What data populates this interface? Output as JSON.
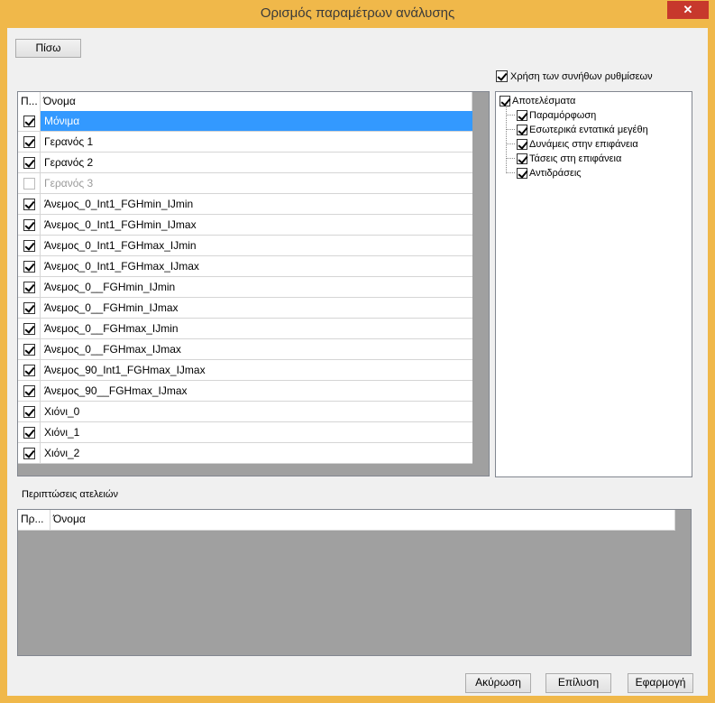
{
  "window": {
    "title": "Ορισμός παραμέτρων ανάλυσης",
    "close_glyph": "✕"
  },
  "toolbar": {
    "back_label": "Πίσω"
  },
  "defaults": {
    "label": "Χρήση των συνήθων ρυθμίσεων",
    "checked": true
  },
  "load_cases": {
    "headers": {
      "check": "Π...",
      "name": "Όνομα"
    },
    "rows": [
      {
        "name": "Μόνιμα",
        "checked": true,
        "selected": true
      },
      {
        "name": "Γερανός 1",
        "checked": true
      },
      {
        "name": "Γερανός 2",
        "checked": true
      },
      {
        "name": "Γερανός 3",
        "checked": false,
        "disabled": true
      },
      {
        "name": "Άνεμος_0_Int1_FGHmin_IJmin",
        "checked": true
      },
      {
        "name": "Άνεμος_0_Int1_FGHmin_IJmax",
        "checked": true
      },
      {
        "name": "Άνεμος_0_Int1_FGHmax_IJmin",
        "checked": true
      },
      {
        "name": "Άνεμος_0_Int1_FGHmax_IJmax",
        "checked": true
      },
      {
        "name": "Άνεμος_0__FGHmin_IJmin",
        "checked": true
      },
      {
        "name": "Άνεμος_0__FGHmin_IJmax",
        "checked": true
      },
      {
        "name": "Άνεμος_0__FGHmax_IJmin",
        "checked": true
      },
      {
        "name": "Άνεμος_0__FGHmax_IJmax",
        "checked": true
      },
      {
        "name": "Άνεμος_90_Int1_FGHmax_IJmax",
        "checked": true
      },
      {
        "name": "Άνεμος_90__FGHmax_IJmax",
        "checked": true
      },
      {
        "name": "Χιόνι_0",
        "checked": true
      },
      {
        "name": "Χιόνι_1",
        "checked": true
      },
      {
        "name": "Χιόνι_2",
        "checked": true
      }
    ]
  },
  "results_tree": {
    "root": {
      "label": "Αποτελέσματα",
      "checked": true
    },
    "children": [
      {
        "label": "Παραμόρφωση",
        "checked": true
      },
      {
        "label": "Εσωτερικά εντατικά μεγέθη",
        "checked": true
      },
      {
        "label": "Δυνάμεις στην επιφάνεια",
        "checked": true
      },
      {
        "label": "Τάσεις στη επιφάνεια",
        "checked": true
      },
      {
        "label": "Αντιδράσεις",
        "checked": true
      }
    ]
  },
  "imperfections": {
    "label": "Περιπτώσεις ατελειών",
    "headers": {
      "check": "Πρ...",
      "name": "Όνομα"
    }
  },
  "footer": {
    "cancel_label": "Ακύρωση",
    "solve_label": "Επίλυση",
    "apply_label": "Εφαρμογή"
  }
}
